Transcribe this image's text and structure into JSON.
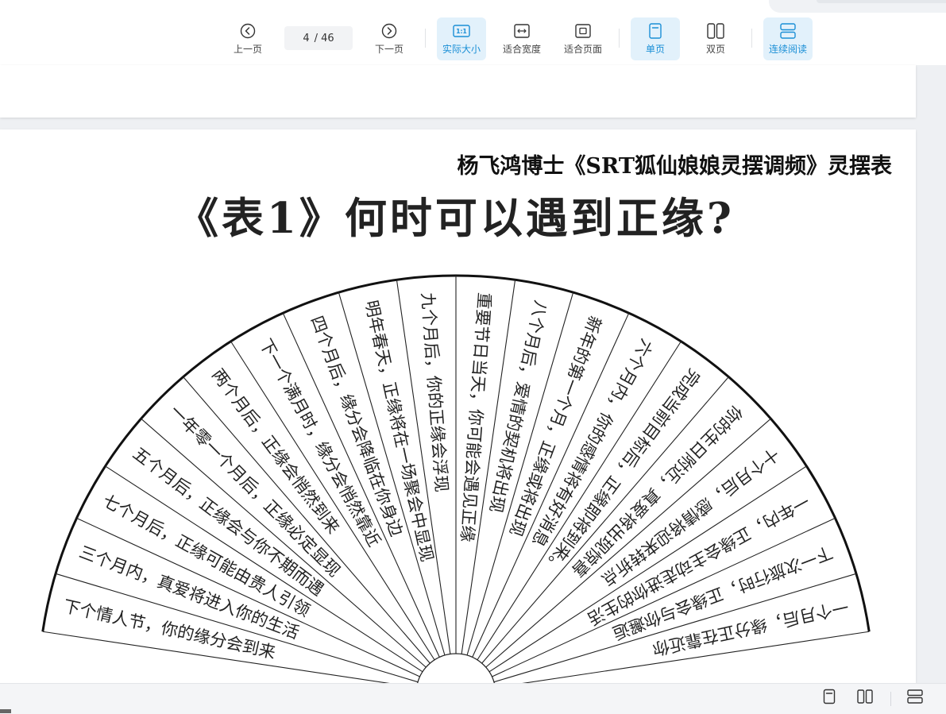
{
  "toolbar": {
    "prev_label": "上一页",
    "next_label": "下一页",
    "current_page": "4",
    "total_pages": "/ 46",
    "actual_size_label": "实际大小",
    "actual_size_icon_text": "1:1",
    "fit_width_label": "适合宽度",
    "fit_page_label": "适合页面",
    "single_page_label": "单页",
    "double_page_label": "双页",
    "continuous_label": "连续阅读",
    "accent_color": "#1a8fd6",
    "active_bg": "#e2f1fb",
    "icons": {
      "prev": "circle-chevron-left-icon",
      "next": "circle-chevron-right-icon",
      "actual_size": "actual-size-icon",
      "fit_width": "fit-width-icon",
      "fit_page": "fit-page-icon",
      "single_page": "single-page-icon",
      "double_page": "double-page-icon",
      "continuous": "continuous-scroll-icon"
    }
  },
  "document": {
    "header": "杨飞鸿博士《SRT狐仙娘娘灵摆调频》灵摆表",
    "title": "《表1》何时可以遇到正缘?",
    "segments": [
      "下个情人节，你的缘分会到来",
      "三个月内，真爱将进入你的生活",
      "七个月后，正缘可能由贵人引领",
      "五个月后，正缘会与你不期而遇",
      "一年零一个月后，正缘必定显现",
      "两个月后，正缘会悄然到来",
      "下一个满月时，缘分会悄然靠近",
      "四个月后，缘分会降临在你身边",
      "明年春天，正缘将在一场聚会中显现",
      "九个月后，你的正缘会浮现",
      "重要节日当天，你可能会遇见正缘",
      "八个月后，爱情的契机将出现",
      "新年的第一个月，正缘或将出现",
      "六个月内，你的感情将有好消息",
      "完成当前目标后，正缘即将到来。",
      "你的生日附近，真爱将出现惊喜",
      "十个月后，感情将迎来转折点",
      "一年内，正缘会主动走进你的生活",
      "下一次旅行时，正缘会与你邂逅",
      "一个月后，缘分正在靠近你"
    ]
  },
  "statusbar": {
    "icons": [
      "single-page-icon",
      "double-page-icon",
      "continuous-scroll-icon"
    ]
  }
}
